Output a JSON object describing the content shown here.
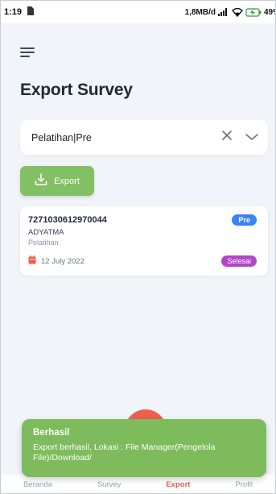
{
  "status_bar": {
    "time": "1:19",
    "network_speed": "1,8MB/d",
    "battery_level": "49%"
  },
  "header": {
    "title": "Export Survey",
    "menu_icon": "hamburger-menu-icon"
  },
  "search": {
    "value": "Pelatihan|Pre",
    "clear_icon": "close-icon",
    "dropdown_icon": "chevron-down-icon"
  },
  "export_button": {
    "label": "Export",
    "icon": "download-icon",
    "color": "#82c063"
  },
  "survey_card": {
    "id": "7271030612970044",
    "name": "ADYATMA",
    "type": "Pelatihan",
    "badge": "Pre",
    "badge_color": "#3b82f6",
    "date": "12 July 2022",
    "status": "Selesai",
    "status_color": "#b146c9"
  },
  "snackbar": {
    "title": "Berhasil",
    "message": "Export berhasil, Lokasi : File Manager(Pengelola File)/Download/",
    "color": "#7dbb5c"
  },
  "bottom_nav": {
    "items": [
      {
        "label": "Beranda",
        "active": false
      },
      {
        "label": "Survey",
        "active": false
      },
      {
        "label": "Export",
        "active": true
      },
      {
        "label": "Profil",
        "active": false
      }
    ],
    "active_color": "#e5635a"
  }
}
